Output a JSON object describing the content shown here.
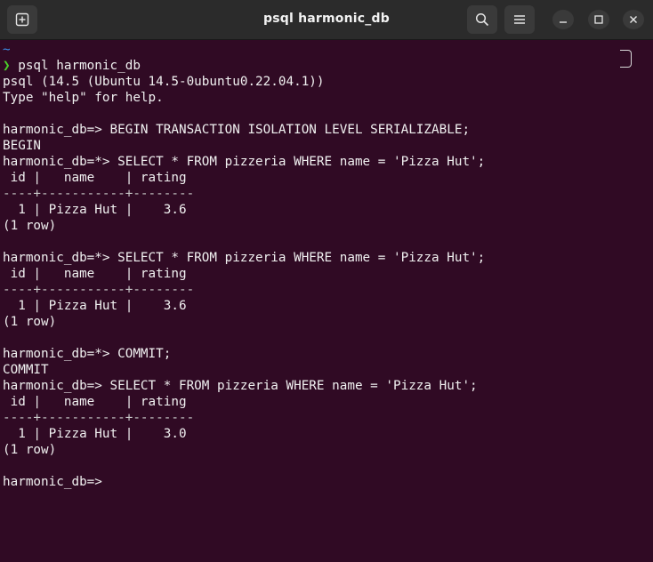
{
  "window": {
    "title": "psql harmonic_db"
  },
  "icons": {
    "new_tab": "new-tab-icon",
    "search": "search-icon",
    "menu": "hamburger-menu-icon",
    "minimize": "minimize-icon",
    "maximize": "maximize-icon",
    "close": "close-icon"
  },
  "colors": {
    "terminal_bg": "#300a24",
    "titlebar_bg": "#2b2b2b",
    "prompt_chevron": "#4bd12a",
    "tilde": "#3b8eea",
    "text": "#f0f0f0"
  },
  "terminal": {
    "tilde": "~",
    "chevron": "❯",
    "lines": [
      " psql harmonic_db",
      "psql (14.5 (Ubuntu 14.5-0ubuntu0.22.04.1))",
      "Type \"help\" for help.",
      "",
      "harmonic_db=> BEGIN TRANSACTION ISOLATION LEVEL SERIALIZABLE;",
      "BEGIN",
      "harmonic_db=*> SELECT * FROM pizzeria WHERE name = 'Pizza Hut';",
      " id |   name    | rating",
      "----+-----------+--------",
      "  1 | Pizza Hut |    3.6",
      "(1 row)",
      "",
      "harmonic_db=*> SELECT * FROM pizzeria WHERE name = 'Pizza Hut';",
      " id |   name    | rating",
      "----+-----------+--------",
      "  1 | Pizza Hut |    3.6",
      "(1 row)",
      "",
      "harmonic_db=*> COMMIT;",
      "COMMIT",
      "harmonic_db=> SELECT * FROM pizzeria WHERE name = 'Pizza Hut';",
      " id |   name    | rating",
      "----+-----------+--------",
      "  1 | Pizza Hut |    3.0",
      "(1 row)",
      "",
      "harmonic_db=> "
    ]
  }
}
